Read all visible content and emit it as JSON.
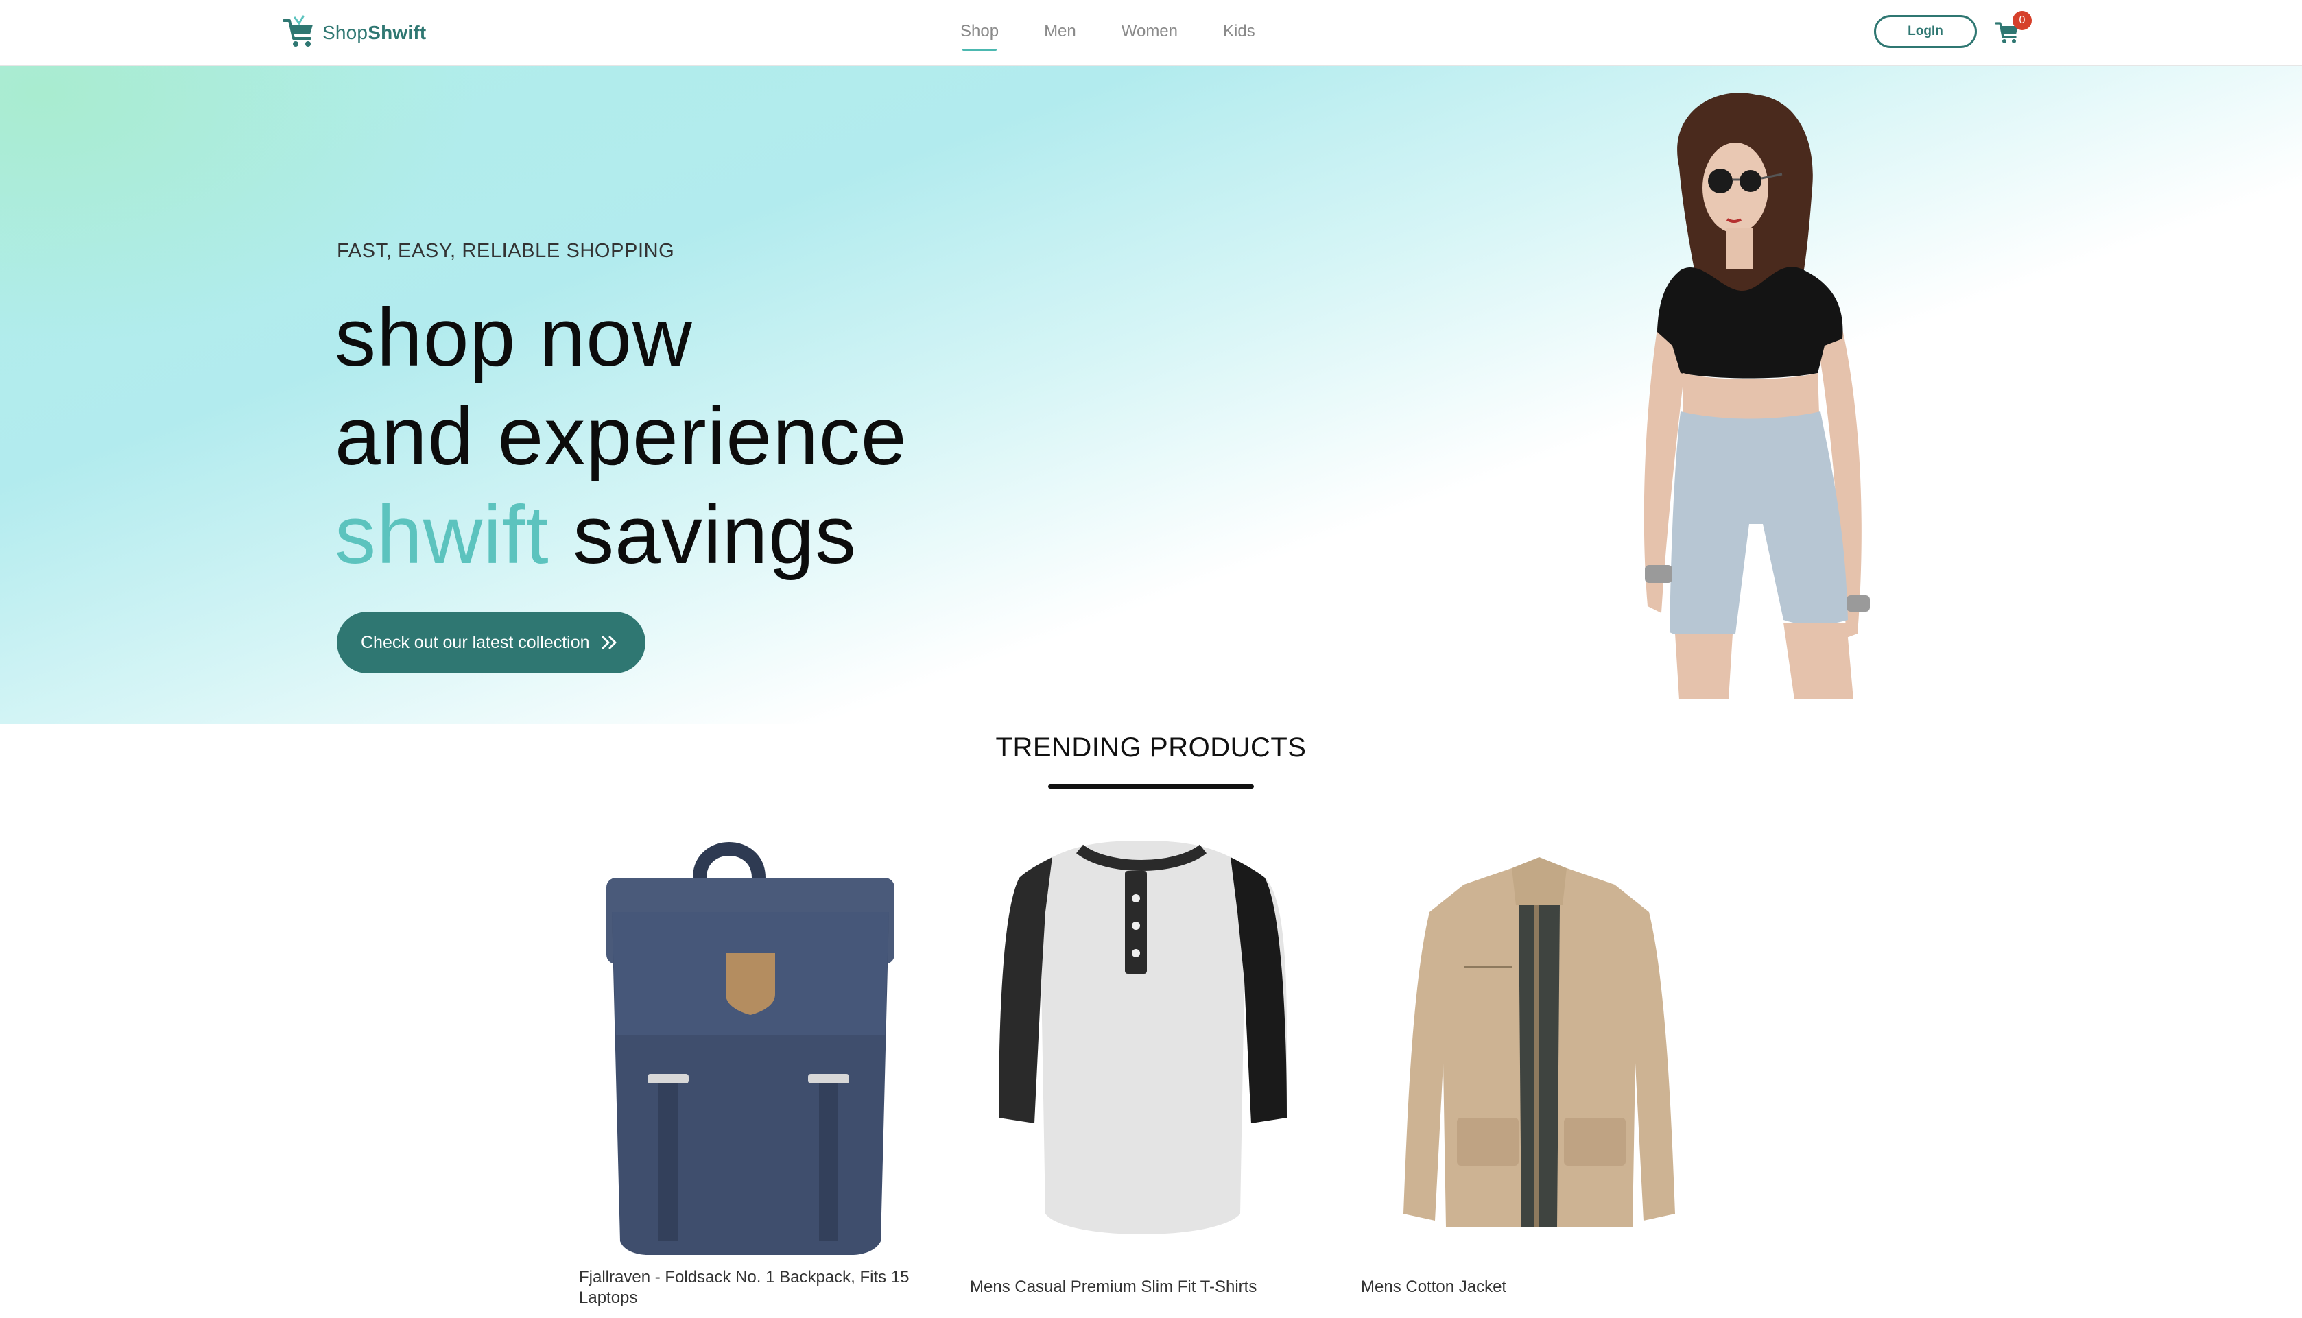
{
  "navbar": {
    "brand": {
      "prefix": "Shop",
      "bold": "Shwift"
    },
    "links": [
      {
        "label": "Shop",
        "active": true
      },
      {
        "label": "Men",
        "active": false
      },
      {
        "label": "Women",
        "active": false
      },
      {
        "label": "Kids",
        "active": false
      }
    ],
    "login_label": "LogIn",
    "cart_count": "0",
    "icons": {
      "logo": "shopping-cart-logo-icon",
      "cart": "cart-icon"
    }
  },
  "hero": {
    "tagline": "FAST, EASY, RELIABLE SHOPPING",
    "line1": "shop now",
    "line2": "and experience",
    "line3_accent": "shwift",
    "line3_rest": "savings",
    "cta_label": "Check out our latest collection",
    "cta_icon": "double-chevron-right-icon"
  },
  "trending": {
    "title": "TRENDING PRODUCTS",
    "products": [
      {
        "name": "Fjallraven - Foldsack No. 1 Backpack, Fits 15 Laptops"
      },
      {
        "name": "Mens Casual Premium Slim Fit T-Shirts"
      },
      {
        "name": "Mens Cotton Jacket"
      }
    ]
  },
  "colors": {
    "brand_teal": "#2f7772",
    "accent_teal": "#5cc3be",
    "badge_red": "#d6402b"
  }
}
